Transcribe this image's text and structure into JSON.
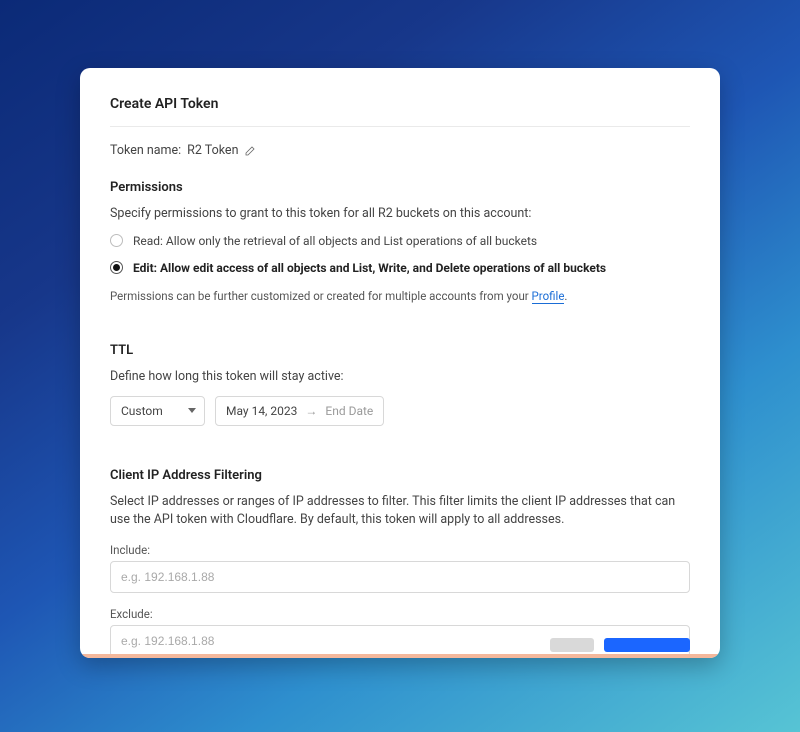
{
  "title": "Create API Token",
  "token_name": {
    "label": "Token name:",
    "value": "R2 Token"
  },
  "permissions": {
    "heading": "Permissions",
    "intro": "Specify permissions to grant to this token for all R2 buckets on this account:",
    "options": {
      "read": "Read: Allow only the retrieval of all objects and List operations of all buckets",
      "edit": "Edit: Allow edit access of all objects and List, Write, and Delete operations of all buckets"
    },
    "footnote_pre": "Permissions can be further customized or created for multiple accounts from your ",
    "footnote_link": "Profile",
    "footnote_post": "."
  },
  "ttl": {
    "heading": "TTL",
    "intro": "Define how long this token will stay active:",
    "select_value": "Custom",
    "start_date": "May 14, 2023",
    "end_date": "End Date"
  },
  "ip": {
    "heading": "Client IP Address Filtering",
    "intro": "Select IP addresses or ranges of IP addresses to filter. This filter limits the client IP addresses that can use the API token with Cloudflare. By default, this token will apply to all addresses.",
    "include_label": "Include:",
    "include_placeholder": "e.g. 192.168.1.88",
    "exclude_label": "Exclude:",
    "exclude_placeholder": "e.g. 192.168.1.88"
  }
}
